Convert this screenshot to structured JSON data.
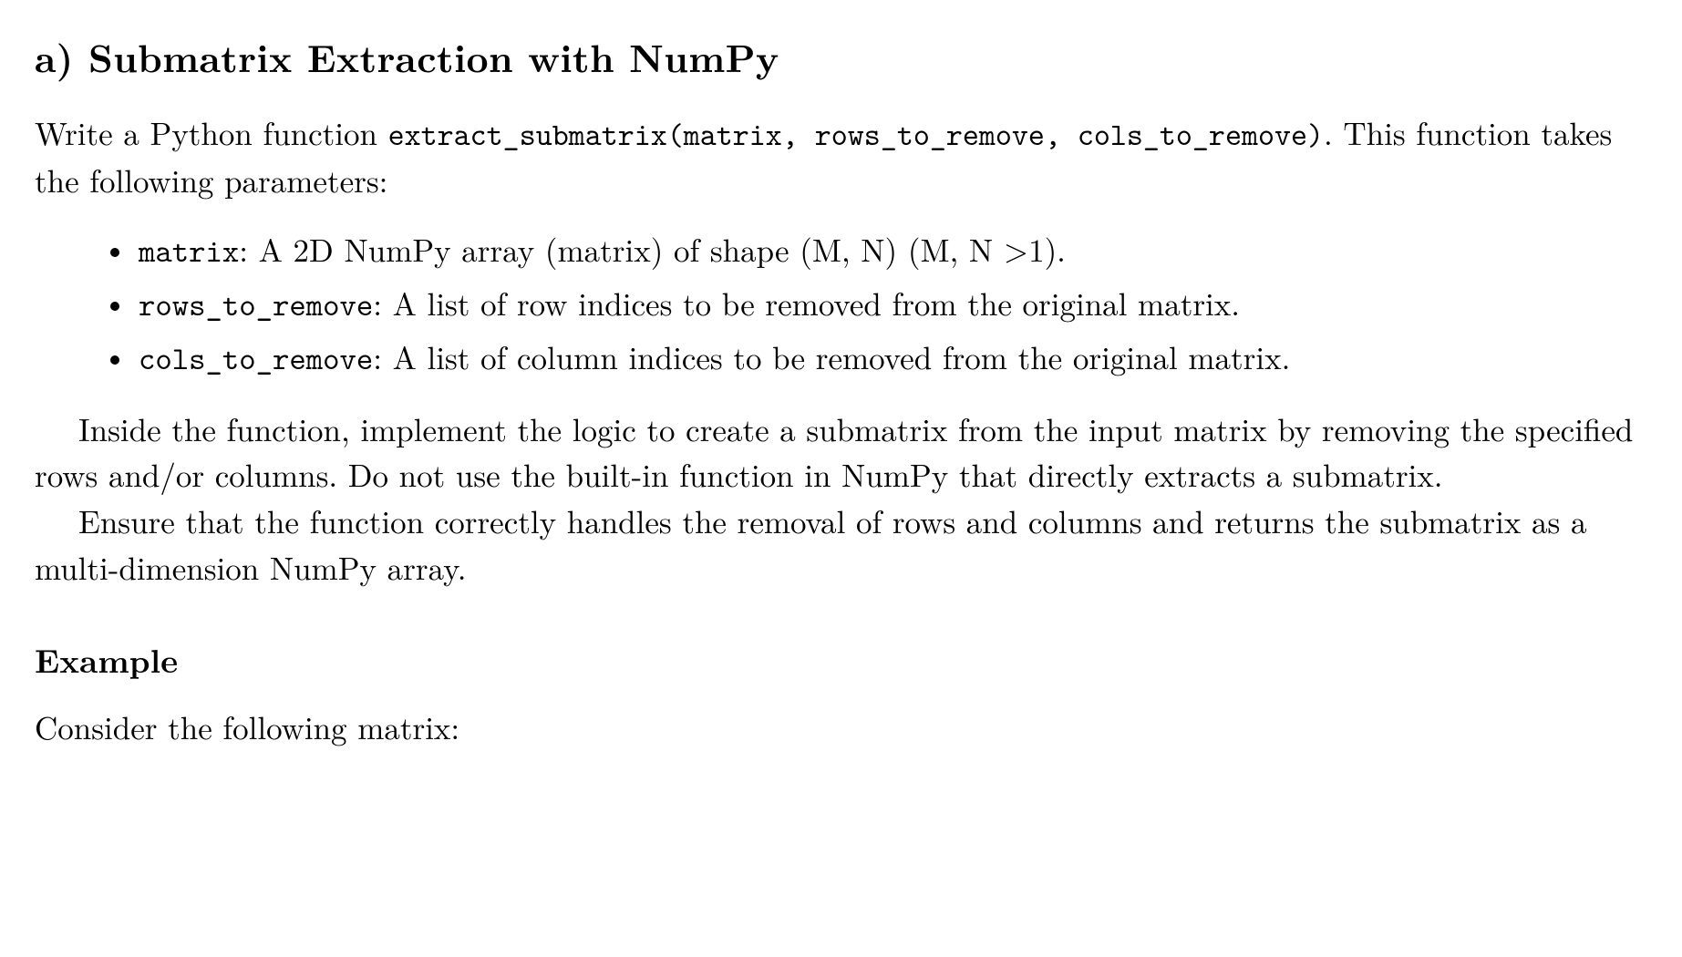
{
  "heading": "a) Submatrix Extraction with NumPy",
  "intro": {
    "pre": "Write a Python function ",
    "func": "extract_submatrix(matrix, rows_to_remove, cols_to_remove)",
    "post": ". This function takes the following parameters:"
  },
  "params": [
    {
      "name": "matrix",
      "desc": ": A 2D NumPy array (matrix) of shape (M, N) (M, N >1)."
    },
    {
      "name": "rows_to_remove",
      "desc": ": A list of row indices to be removed from the original matrix."
    },
    {
      "name": "cols_to_remove",
      "desc": ": A list of column indices to be removed from the original matrix."
    }
  ],
  "body": {
    "p1": "Inside the function, implement the logic to create a submatrix from the input matrix by removing the specified rows and/or columns. Do not use the built-in function in NumPy that directly extracts a submatrix.",
    "p2": "Ensure that the function correctly handles the removal of rows and columns and returns the submatrix as a multi-dimension NumPy array."
  },
  "example": {
    "heading": "Example",
    "lead": "Consider the following matrix:"
  }
}
